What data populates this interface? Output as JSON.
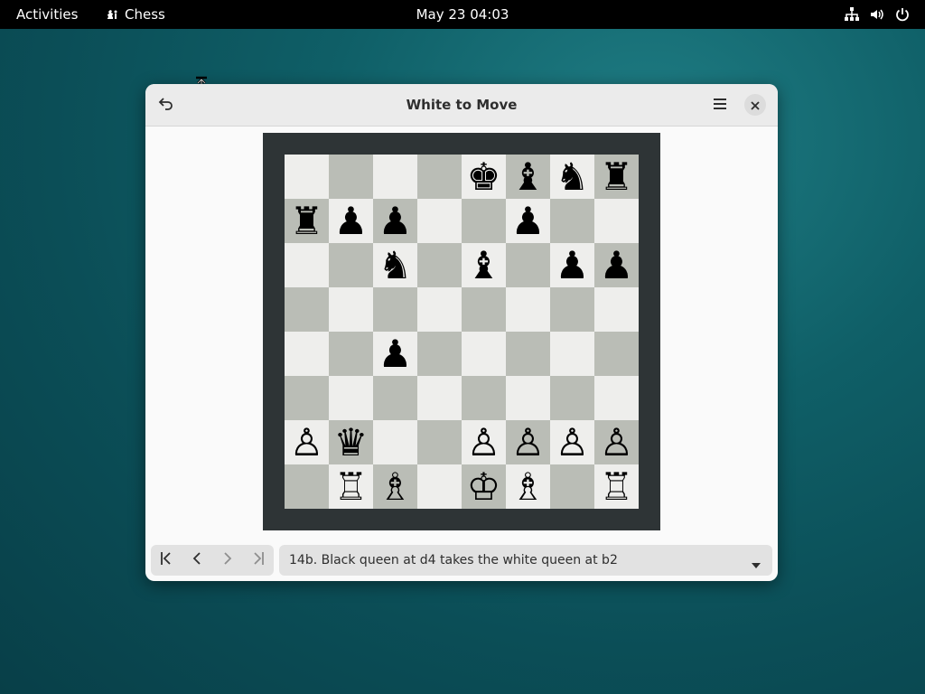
{
  "topbar": {
    "activities": "Activities",
    "app_name": "Chess",
    "app_icon": "chess-app-icon",
    "clock": "May 23  04:03",
    "tray_icons": [
      "network-icon",
      "volume-icon",
      "power-icon"
    ]
  },
  "window": {
    "title": "White to Move",
    "back_icon": "undo-icon",
    "menu_icon": "hamburger-menu-icon",
    "close_icon": "close-icon"
  },
  "colors": {
    "light_square": "#eeeeec",
    "dark_square": "#babdb6",
    "board_border": "#2e3436"
  },
  "board": {
    "rows": [
      [
        "",
        "",
        "",
        "",
        "♚",
        "♝",
        "♞",
        "♜"
      ],
      [
        "♜",
        "♟",
        "♟",
        "",
        "",
        "♟",
        "",
        ""
      ],
      [
        "",
        "",
        "♞",
        "",
        "♝",
        "",
        "♟",
        "♟"
      ],
      [
        "",
        "",
        "",
        "",
        "",
        "",
        "",
        ""
      ],
      [
        "",
        "",
        "♟",
        "",
        "",
        "",
        "",
        ""
      ],
      [
        "",
        "",
        "",
        "",
        "",
        "",
        "",
        ""
      ],
      [
        "♙",
        "♛",
        "",
        "",
        "♙",
        "♙",
        "♙",
        "♙"
      ],
      [
        "",
        "♖",
        "♗",
        "",
        "♔",
        "♗",
        "",
        "♖"
      ]
    ]
  },
  "history": {
    "nav": [
      "first-move-icon",
      "previous-move-icon",
      "next-move-icon",
      "last-move-icon"
    ],
    "current_move": "14b. Black queen at d4 takes the white queen at b2",
    "dropdown_icon": "dropdown-arrow-icon"
  }
}
